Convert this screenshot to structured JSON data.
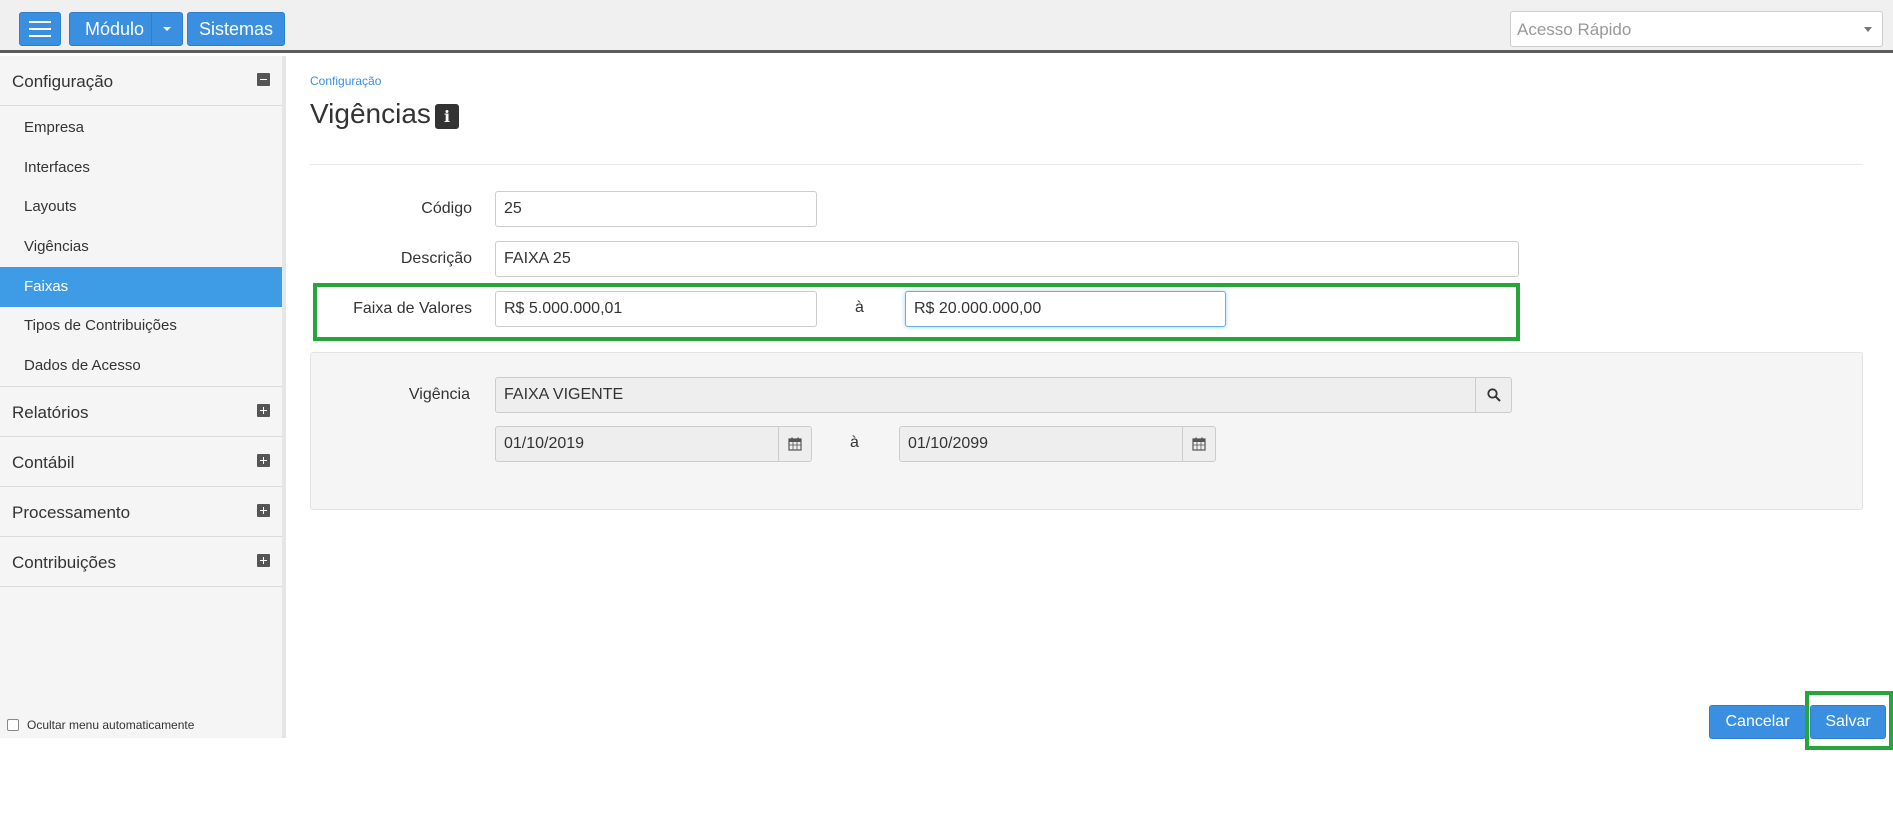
{
  "topbar": {
    "menu_icon": "hamburger-menu-icon",
    "modulo_label": "Módulo",
    "sistemas_label": "Sistemas",
    "acesso_rapido_placeholder": "Acesso Rápido"
  },
  "sidebar": {
    "sections": [
      {
        "label": "Configuração",
        "expanded": true
      },
      {
        "label": "Relatórios",
        "expanded": false
      },
      {
        "label": "Contábil",
        "expanded": false
      },
      {
        "label": "Processamento",
        "expanded": false
      },
      {
        "label": "Contribuições",
        "expanded": false
      }
    ],
    "config_items": [
      {
        "label": "Empresa"
      },
      {
        "label": "Interfaces"
      },
      {
        "label": "Layouts"
      },
      {
        "label": "Vigências"
      },
      {
        "label": "Faixas",
        "active": true
      },
      {
        "label": "Tipos de Contribuições"
      },
      {
        "label": "Dados de Acesso"
      }
    ],
    "ocultar_label": "Ocultar menu automaticamente"
  },
  "main": {
    "breadcrumb": "Configuração",
    "title": "Vigências",
    "form": {
      "codigo_label": "Código",
      "codigo_value": "25",
      "descricao_label": "Descrição",
      "descricao_value": "FAIXA 25",
      "faixa_label": "Faixa de Valores",
      "faixa_from": "R$ 5.000.000,01",
      "faixa_sep": "à",
      "faixa_to": "R$ 20.000.000,00"
    },
    "vigencia": {
      "label": "Vigência",
      "value": "FAIXA VIGENTE",
      "date_from": "01/10/2019",
      "date_sep": "à",
      "date_to": "01/10/2099"
    },
    "buttons": {
      "cancelar": "Cancelar",
      "salvar": "Salvar"
    }
  },
  "colors": {
    "accent": "#3a8fe0",
    "active_menu": "#3d9ce5",
    "highlight": "#25a53a"
  }
}
